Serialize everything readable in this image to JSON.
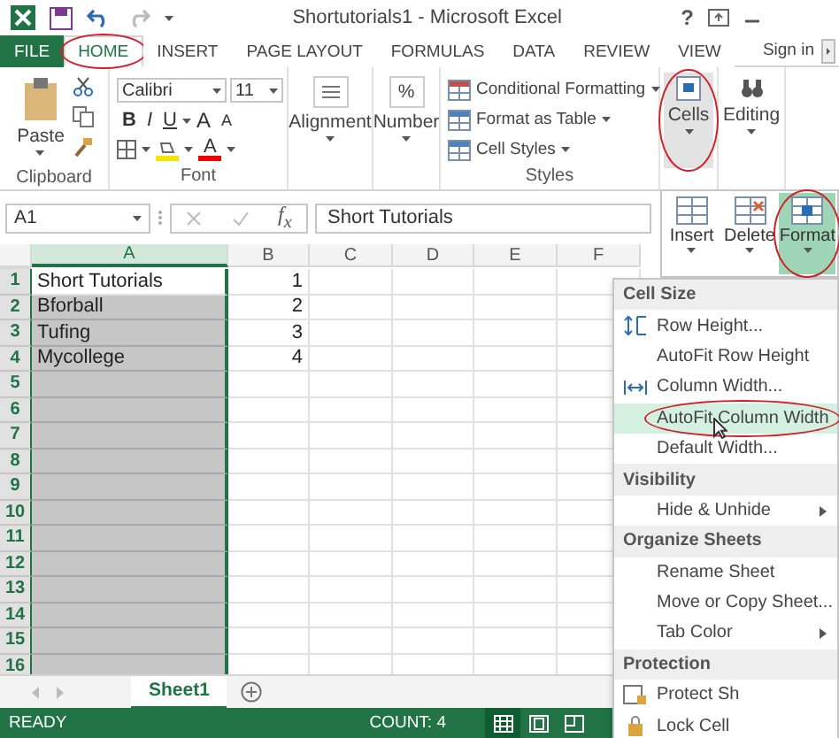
{
  "window": {
    "title": "Shortutorials1 - Microsoft Excel",
    "help": "?"
  },
  "ribbon_tabs": [
    {
      "label": "FILE",
      "kind": "file",
      "selected": false,
      "circled": false
    },
    {
      "label": "HOME",
      "kind": "tab",
      "selected": true,
      "circled": true
    },
    {
      "label": "INSERT",
      "kind": "tab",
      "selected": false,
      "circled": false
    },
    {
      "label": "PAGE LAYOUT",
      "kind": "tab",
      "selected": false,
      "circled": false
    },
    {
      "label": "FORMULAS",
      "kind": "tab",
      "selected": false,
      "circled": false
    },
    {
      "label": "DATA",
      "kind": "tab",
      "selected": false,
      "circled": false
    },
    {
      "label": "REVIEW",
      "kind": "tab",
      "selected": false,
      "circled": false
    },
    {
      "label": "VIEW",
      "kind": "tab",
      "selected": false,
      "circled": false
    }
  ],
  "sign_in": "Sign in",
  "ribbon": {
    "clipboard": {
      "paste": "Paste",
      "label": "Clipboard"
    },
    "font": {
      "name": "Calibri",
      "size": "11",
      "bold": "B",
      "italic": "I",
      "underline": "U",
      "grow": "A",
      "shrink": "A",
      "font_color_label": "A",
      "label": "Font"
    },
    "alignment": "Alignment",
    "number": {
      "symbol": "%",
      "label": "Number"
    },
    "styles": {
      "items": [
        "Conditional Formatting",
        "Format as Table",
        "Cell Styles"
      ],
      "label": "Styles"
    },
    "cells": {
      "label": "Cells",
      "pressed": true,
      "circled": true
    },
    "editing": "Editing"
  },
  "cells_panel": [
    {
      "label": "Insert",
      "selected": false,
      "circled": false
    },
    {
      "label": "Delete",
      "selected": false,
      "circled": false
    },
    {
      "label": "Format",
      "selected": true,
      "circled": true
    }
  ],
  "formula_bar": {
    "name_box": "A1",
    "fx": "f$_{x}$",
    "value": "Short Tutorials"
  },
  "sheet": {
    "columns": [
      {
        "label": "A",
        "selected": true
      },
      {
        "label": "B",
        "selected": false
      },
      {
        "label": "C",
        "selected": false
      },
      {
        "label": "D",
        "selected": false
      },
      {
        "label": "E",
        "selected": false
      },
      {
        "label": "F",
        "selected": false
      }
    ],
    "rows": [
      {
        "number": "1",
        "a": "Short Tutorials",
        "b": "1",
        "a_selected": false
      },
      {
        "number": "2",
        "a": "Bforball",
        "b": "2",
        "a_selected": true
      },
      {
        "number": "3",
        "a": "Tufing",
        "b": "3",
        "a_selected": true
      },
      {
        "number": "4",
        "a": "Mycollege",
        "b": "4",
        "a_selected": true
      },
      {
        "number": "5",
        "a_selected": true
      },
      {
        "number": "6",
        "a_selected": true
      },
      {
        "number": "7",
        "a_selected": true
      },
      {
        "number": "8",
        "a_selected": true
      },
      {
        "number": "9",
        "a_selected": true
      },
      {
        "number": "10",
        "a_selected": true
      },
      {
        "number": "11",
        "a_selected": true
      },
      {
        "number": "12",
        "a_selected": true
      },
      {
        "number": "13",
        "a_selected": true
      },
      {
        "number": "14",
        "a_selected": true
      },
      {
        "number": "15",
        "a_selected": true
      },
      {
        "number": "16",
        "a_selected": true
      }
    ]
  },
  "format_menu": [
    {
      "kind": "header",
      "label": "Cell Size"
    },
    {
      "kind": "item",
      "label": "Row Height...",
      "highlighted": false,
      "circled": false
    },
    {
      "kind": "item",
      "label": "AutoFit Row Height",
      "highlighted": false,
      "circled": false
    },
    {
      "kind": "item",
      "label": "Column Width...",
      "highlighted": false,
      "circled": false
    },
    {
      "kind": "item",
      "label": "AutoFit Column Width",
      "highlighted": true,
      "circled": true
    },
    {
      "kind": "item",
      "label": "Default Width...",
      "highlighted": false,
      "circled": false
    },
    {
      "kind": "header",
      "label": "Visibility"
    },
    {
      "kind": "submenu",
      "label": "Hide & Unhide",
      "highlighted": false,
      "circled": false
    },
    {
      "kind": "header",
      "label": "Organize Sheets"
    },
    {
      "kind": "item",
      "label": "Rename Sheet",
      "highlighted": false,
      "circled": false
    },
    {
      "kind": "item",
      "label": "Move or Copy Sheet...",
      "highlighted": false,
      "circled": false
    },
    {
      "kind": "submenu",
      "label": "Tab Color",
      "highlighted": false,
      "circled": false
    },
    {
      "kind": "header",
      "label": "Protection"
    },
    {
      "kind": "item",
      "label": "Protect Sh",
      "highlighted": false,
      "circled": false
    },
    {
      "kind": "item",
      "label": "Lock Cell",
      "highlighted": false,
      "circled": false
    }
  ],
  "sheet_tabs": [
    {
      "label": "Sheet1",
      "selected": true
    }
  ],
  "status_bar": {
    "mode": "READY",
    "count": "COUNT: 4",
    "views": [
      {
        "selected": true
      },
      {
        "selected": false
      },
      {
        "selected": false
      }
    ]
  }
}
